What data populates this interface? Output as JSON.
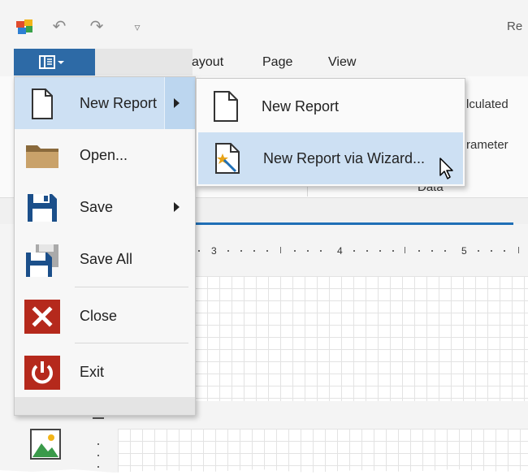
{
  "window": {
    "title": "Re",
    "qat": [
      {
        "name": "app-logo-icon"
      },
      {
        "name": "undo-icon",
        "glyph": "↶"
      },
      {
        "name": "redo-icon",
        "glyph": "↷"
      },
      {
        "name": "customize-qat-icon",
        "glyph": "▿"
      }
    ]
  },
  "ribbon": {
    "tabs": [
      "ayout",
      "Page",
      "View"
    ],
    "group_texts": [
      "lculated",
      "rameter",
      "Data"
    ]
  },
  "ruler": {
    "labels": [
      "3",
      "4",
      "5"
    ]
  },
  "app_menu": {
    "items": [
      {
        "label": "New Report",
        "icon": "new-report-icon",
        "has_submenu": true,
        "highlighted": true
      },
      {
        "label": "Open...",
        "icon": "folder-icon",
        "has_submenu": false
      },
      {
        "label": "Save",
        "icon": "save-icon",
        "has_submenu": true
      },
      {
        "label": "Save All",
        "icon": "save-all-icon",
        "has_submenu": false
      },
      {
        "label": "Close",
        "icon": "close-icon",
        "has_submenu": false
      },
      {
        "label": "Exit",
        "icon": "power-icon",
        "has_submenu": false
      }
    ]
  },
  "submenu": {
    "items": [
      {
        "label": "New Report",
        "icon": "document-icon"
      },
      {
        "label": "New Report via Wizard...",
        "icon": "wizard-icon",
        "highlighted": true
      }
    ]
  },
  "colors": {
    "file_tab": "#2d6aa6",
    "highlight": "#cde0f3",
    "accent_line": "#1f6fb6",
    "close_red": "#b5291c",
    "save_blue": "#1b4f8a"
  }
}
